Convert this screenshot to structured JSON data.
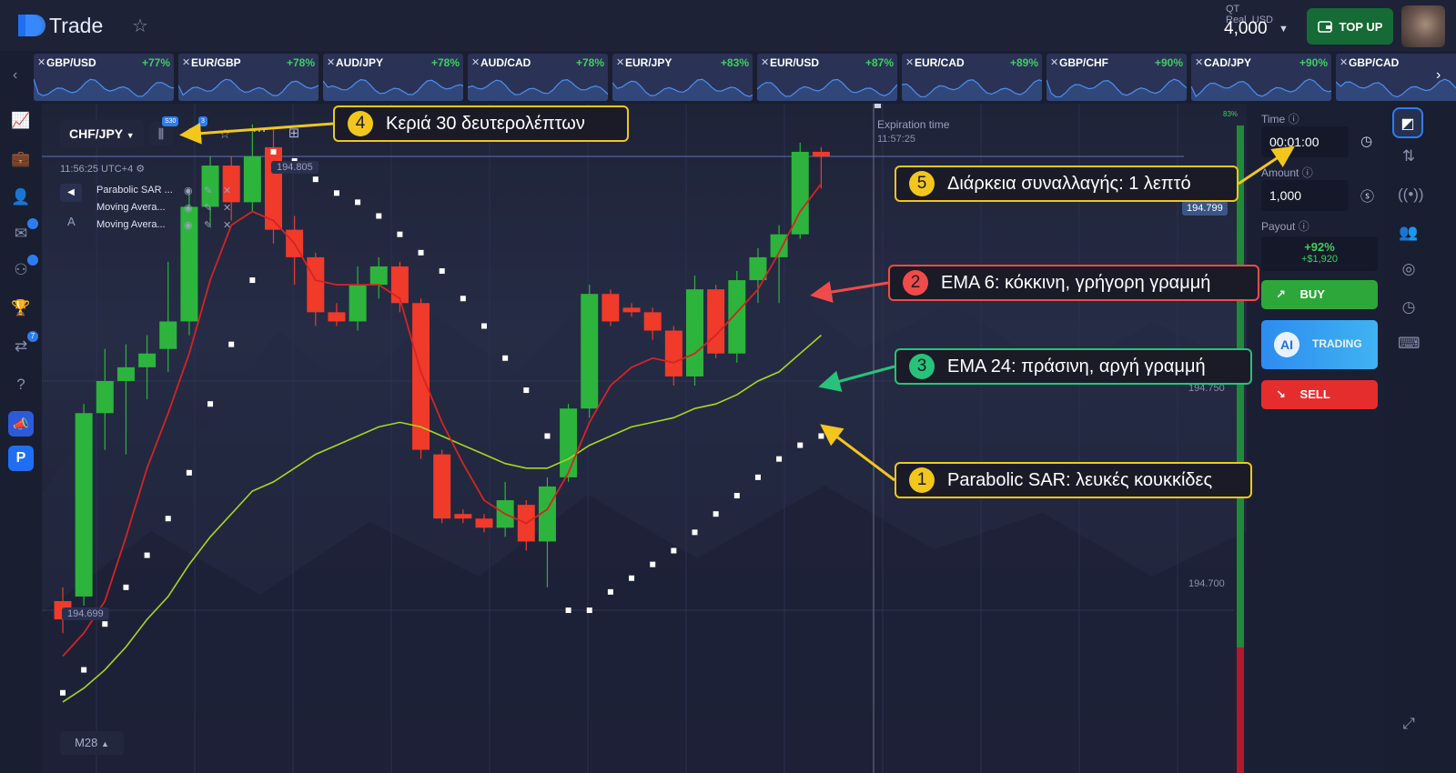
{
  "app": {
    "name": "Trade"
  },
  "account": {
    "type": "QT Real",
    "currency": "USD",
    "balance": "4,000"
  },
  "topup_label": "TOP UP",
  "pairs": [
    {
      "name": "GBP/USD",
      "pct": "+77%"
    },
    {
      "name": "EUR/GBP",
      "pct": "+78%"
    },
    {
      "name": "AUD/JPY",
      "pct": "+78%"
    },
    {
      "name": "AUD/CAD",
      "pct": "+78%"
    },
    {
      "name": "EUR/JPY",
      "pct": "+83%"
    },
    {
      "name": "EUR/USD",
      "pct": "+87%"
    },
    {
      "name": "EUR/CAD",
      "pct": "+89%"
    },
    {
      "name": "GBP/CHF",
      "pct": "+90%"
    },
    {
      "name": "CAD/JPY",
      "pct": "+90%"
    },
    {
      "name": "GBP/CAD",
      "pct": ""
    }
  ],
  "leftbar_badges": {
    "chat": "",
    "community": "",
    "referral": "7"
  },
  "chart": {
    "symbol": "CHF/JPY",
    "toolbar_badges": {
      "candles": "S30",
      "drawings": "3"
    },
    "clock": "11:56:25 UTC+4",
    "high_label": "194.805",
    "low_label": "194.699",
    "current_price": "194.799",
    "price_levels": [
      "194.750",
      "194.700"
    ],
    "timeframe": "M28",
    "green_bar_pct": "83%",
    "expiration_label": "Expiration time",
    "expiration_time": "11:57:25",
    "indicators": [
      {
        "name": "Parabolic SAR ..."
      },
      {
        "name": "Moving Avera..."
      },
      {
        "name": "Moving Avera..."
      }
    ]
  },
  "trade_panel": {
    "time_label": "Time",
    "time_value": "00:01:00",
    "amount_label": "Amount",
    "amount_value": "1,000",
    "payout_label": "Payout",
    "payout_pct": "+92%",
    "payout_value": "+$1,920",
    "buy_label": "BUY",
    "ai_label": "AI",
    "ai_trading_label": "TRADING",
    "sell_label": "SELL"
  },
  "callouts": [
    {
      "num": "4",
      "text": "Κεριά 30 δευτερολέπτων",
      "color": "#f2c61c"
    },
    {
      "num": "5",
      "text": "Διάρκεια συναλλαγής: 1 λεπτό",
      "color": "#f2c61c"
    },
    {
      "num": "2",
      "text": "EMA 6: κόκκινη, γρήγορη γραμμή",
      "color": "#f04b4b"
    },
    {
      "num": "3",
      "text": "EMA 24: πράσινη, αργή γραμμή",
      "color": "#28c27a"
    },
    {
      "num": "1",
      "text": "Parabolic SAR: λευκές κουκκίδες",
      "color": "#f2c61c"
    }
  ],
  "colors": {
    "up": "#2db43c",
    "down": "#f03a2a",
    "ema_fast": "#d42424",
    "ema_slow": "#a6d81e",
    "accent": "#2d7df0"
  },
  "candles": [
    {
      "o": 194.702,
      "c": 194.698,
      "h": 194.705,
      "l": 194.695
    },
    {
      "o": 194.703,
      "c": 194.743,
      "h": 194.745,
      "l": 194.701
    },
    {
      "o": 194.743,
      "c": 194.75,
      "h": 194.757,
      "l": 194.735
    },
    {
      "o": 194.75,
      "c": 194.753,
      "h": 194.758,
      "l": 194.734
    },
    {
      "o": 194.753,
      "c": 194.756,
      "h": 194.76,
      "l": 194.746
    },
    {
      "o": 194.757,
      "c": 194.763,
      "h": 194.776,
      "l": 194.752
    },
    {
      "o": 194.763,
      "c": 194.788,
      "h": 194.792,
      "l": 194.76
    },
    {
      "o": 194.788,
      "c": 194.797,
      "h": 194.799,
      "l": 194.784
    },
    {
      "o": 194.797,
      "c": 194.789,
      "h": 194.799,
      "l": 194.785
    },
    {
      "o": 194.789,
      "c": 194.799,
      "h": 194.806,
      "l": 194.787
    },
    {
      "o": 194.801,
      "c": 194.783,
      "h": 194.805,
      "l": 194.78
    },
    {
      "o": 194.783,
      "c": 194.777,
      "h": 194.786,
      "l": 194.771
    },
    {
      "o": 194.777,
      "c": 194.765,
      "h": 194.778,
      "l": 194.762
    },
    {
      "o": 194.765,
      "c": 194.763,
      "h": 194.767,
      "l": 194.762
    },
    {
      "o": 194.763,
      "c": 194.771,
      "h": 194.775,
      "l": 194.761
    },
    {
      "o": 194.771,
      "c": 194.775,
      "h": 194.777,
      "l": 194.768
    },
    {
      "o": 194.775,
      "c": 194.767,
      "h": 194.776,
      "l": 194.765
    },
    {
      "o": 194.767,
      "c": 194.735,
      "h": 194.768,
      "l": 194.733
    },
    {
      "o": 194.734,
      "c": 194.72,
      "h": 194.735,
      "l": 194.719
    },
    {
      "o": 194.721,
      "c": 194.72,
      "h": 194.722,
      "l": 194.719
    },
    {
      "o": 194.72,
      "c": 194.718,
      "h": 194.721,
      "l": 194.717
    },
    {
      "o": 194.718,
      "c": 194.724,
      "h": 194.728,
      "l": 194.716
    },
    {
      "o": 194.723,
      "c": 194.715,
      "h": 194.724,
      "l": 194.713
    },
    {
      "o": 194.715,
      "c": 194.727,
      "h": 194.729,
      "l": 194.705
    },
    {
      "o": 194.729,
      "c": 194.744,
      "h": 194.745,
      "l": 194.728
    },
    {
      "o": 194.744,
      "c": 194.769,
      "h": 194.771,
      "l": 194.742
    },
    {
      "o": 194.769,
      "c": 194.763,
      "h": 194.77,
      "l": 194.762
    },
    {
      "o": 194.766,
      "c": 194.765,
      "h": 194.767,
      "l": 194.764
    },
    {
      "o": 194.765,
      "c": 194.761,
      "h": 194.766,
      "l": 194.759
    },
    {
      "o": 194.761,
      "c": 194.751,
      "h": 194.762,
      "l": 194.749
    },
    {
      "o": 194.751,
      "c": 194.77,
      "h": 194.773,
      "l": 194.749
    },
    {
      "o": 194.77,
      "c": 194.756,
      "h": 194.771,
      "l": 194.755
    },
    {
      "o": 194.756,
      "c": 194.772,
      "h": 194.774,
      "l": 194.754
    },
    {
      "o": 194.772,
      "c": 194.777,
      "h": 194.779,
      "l": 194.767
    },
    {
      "o": 194.777,
      "c": 194.782,
      "h": 194.784,
      "l": 194.767
    },
    {
      "o": 194.782,
      "c": 194.8,
      "h": 194.802,
      "l": 194.781
    },
    {
      "o": 194.8,
      "c": 194.799,
      "h": 194.801,
      "l": 194.792
    }
  ],
  "ema_fast": [
    194.69,
    194.695,
    194.702,
    194.716,
    194.731,
    194.743,
    194.756,
    194.772,
    194.784,
    194.787,
    194.785,
    194.78,
    194.772,
    194.771,
    194.771,
    194.771,
    194.768,
    194.752,
    194.741,
    194.732,
    194.724,
    194.721,
    194.719,
    194.722,
    194.73,
    194.741,
    194.749,
    194.753,
    194.755,
    194.754,
    194.756,
    194.76,
    194.765,
    194.77,
    194.778,
    194.787,
    194.793
  ],
  "ema_slow": [
    194.68,
    194.683,
    194.687,
    194.692,
    194.698,
    194.703,
    194.71,
    194.716,
    194.721,
    194.726,
    194.728,
    194.731,
    194.734,
    194.736,
    194.738,
    194.74,
    194.741,
    194.74,
    194.738,
    194.736,
    194.734,
    194.732,
    194.731,
    194.731,
    194.733,
    194.736,
    194.738,
    194.74,
    194.741,
    194.742,
    194.744,
    194.745,
    194.747,
    194.75,
    194.752,
    194.756,
    194.76
  ],
  "sar": [
    194.682,
    194.687,
    194.697,
    194.705,
    194.712,
    194.72,
    194.73,
    194.745,
    194.758,
    194.772,
    194.8,
    194.798,
    194.794,
    194.791,
    194.789,
    194.786,
    194.782,
    194.778,
    194.774,
    194.768,
    194.762,
    194.755,
    194.748,
    194.738,
    194.7,
    194.7,
    194.704,
    194.707,
    194.71,
    194.713,
    194.717,
    194.721,
    194.725,
    194.729,
    194.733,
    194.736,
    194.738
  ]
}
